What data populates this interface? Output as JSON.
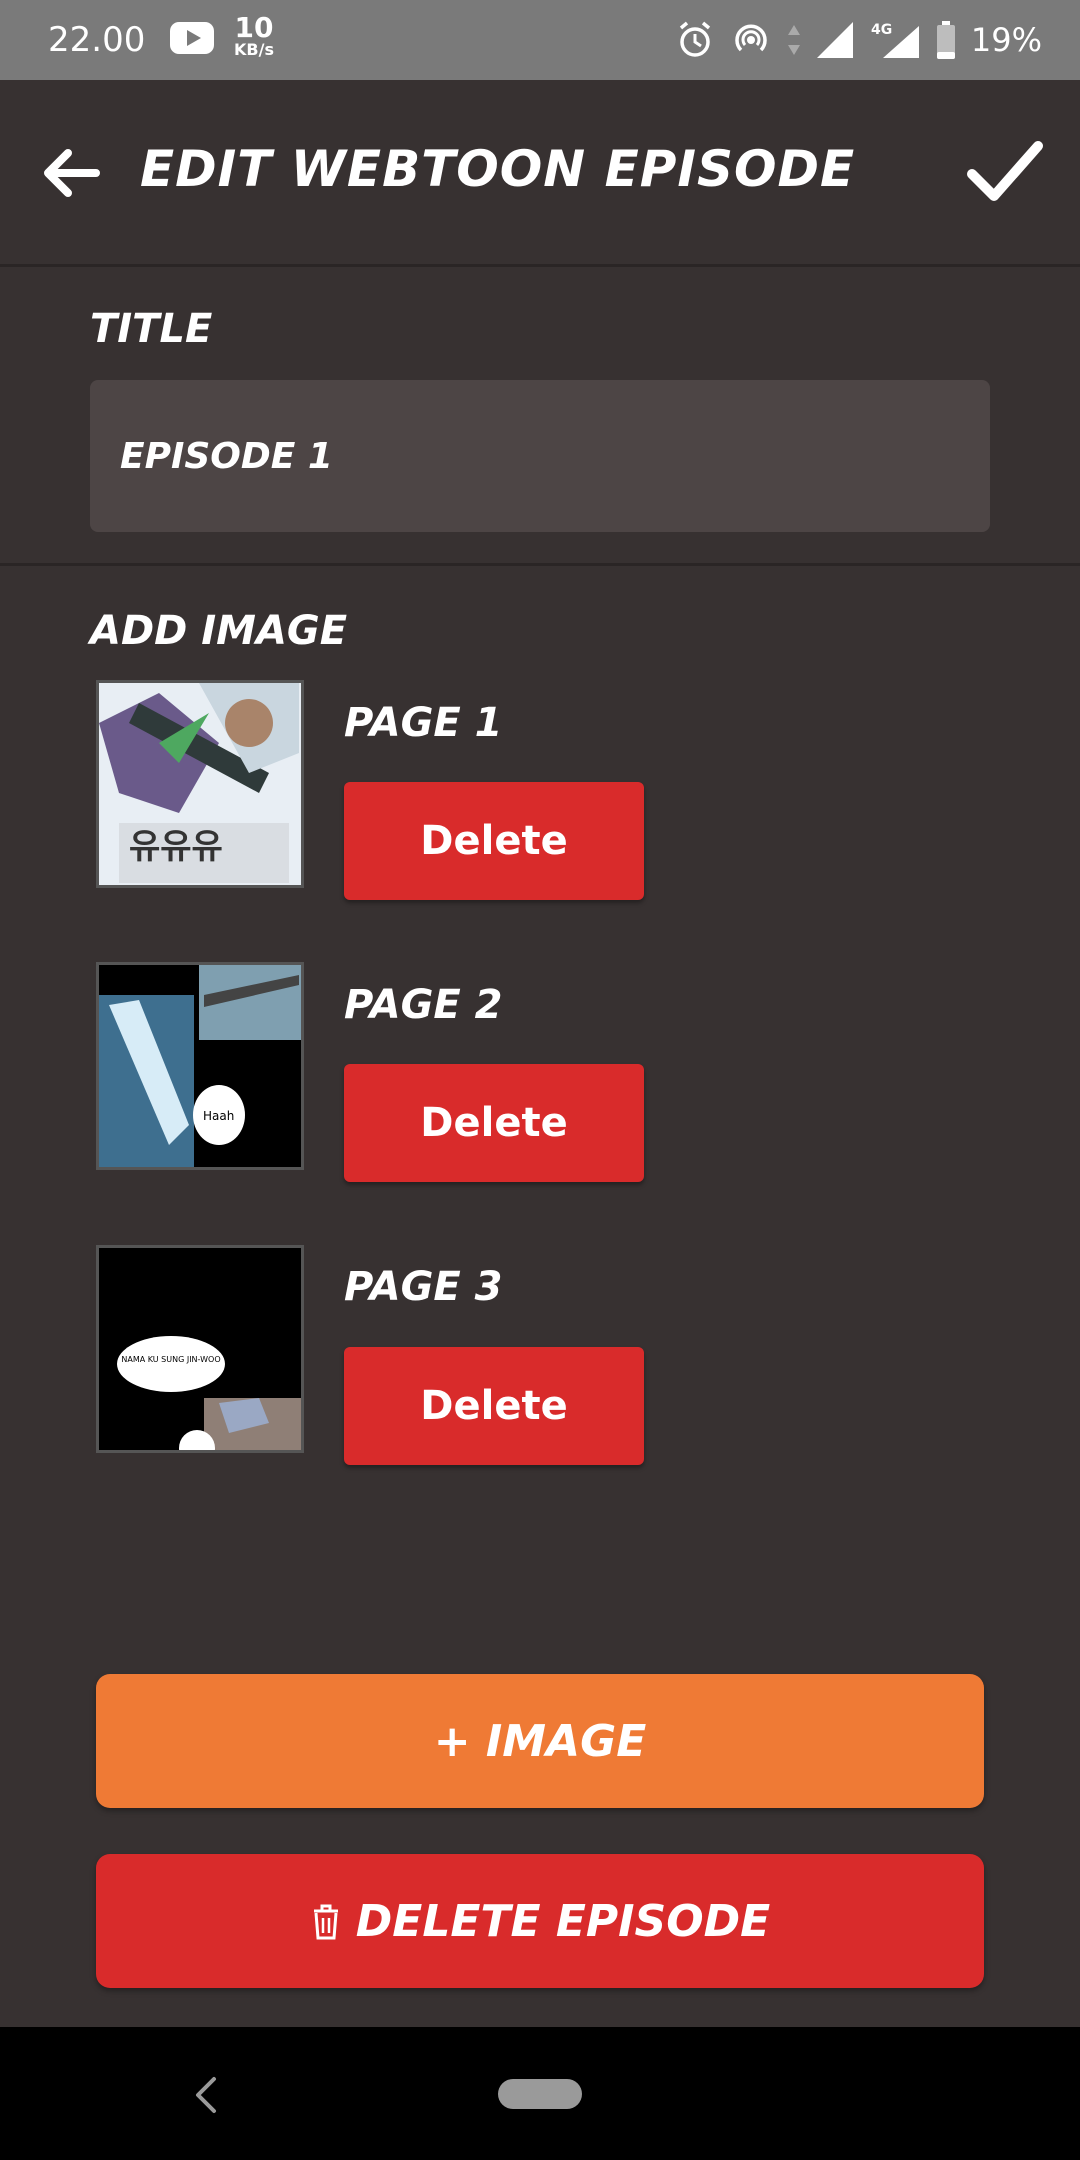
{
  "status_bar": {
    "time": "22.00",
    "speed_value": "10",
    "speed_unit": "KB/s",
    "network": "4G",
    "battery": "19%"
  },
  "app_bar": {
    "title": "EDIT WEBTOON EPISODE",
    "back_icon": "arrow-left-icon",
    "confirm_icon": "check-icon"
  },
  "title_section": {
    "label": "TITLE",
    "value": "EPISODE 1"
  },
  "images_section": {
    "label": "ADD IMAGE",
    "pages": [
      {
        "label": "PAGE 1",
        "delete_label": "Delete"
      },
      {
        "label": "PAGE 2",
        "delete_label": "Delete",
        "bubble_text": "Haah"
      },
      {
        "label": "PAGE 3",
        "delete_label": "Delete",
        "bubble_text": "NAMA KU SUNG JIN-WOO"
      }
    ]
  },
  "actions": {
    "add_image_label": "+ IMAGE",
    "delete_episode_label": "DELETE EPISODE"
  },
  "colors": {
    "background": "#373131",
    "input": "#4d4545",
    "danger": "#d92b2b",
    "accent": "#ef7a35"
  }
}
